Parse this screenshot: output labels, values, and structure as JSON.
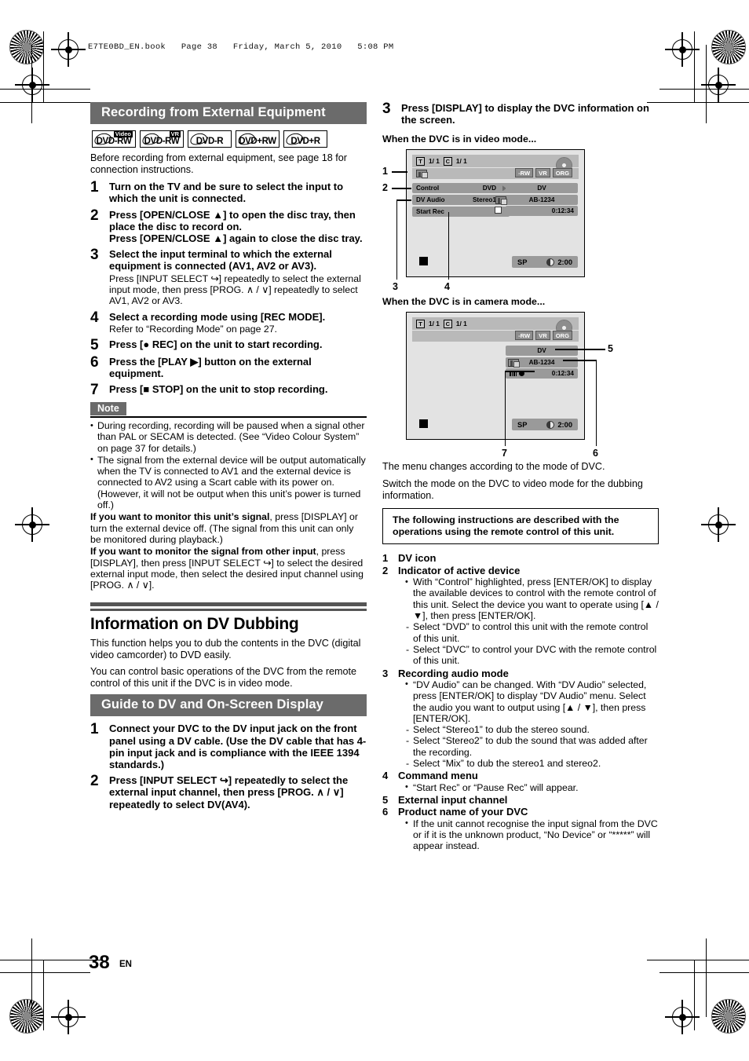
{
  "header": {
    "book_line": "E7TE0BD_EN.book   Page 38   Friday, March 5, 2010   5:08 PM"
  },
  "footer": {
    "page_number": "38",
    "language": "EN"
  },
  "left_column": {
    "section1_title": "Recording from External Equipment",
    "disc_logos": [
      {
        "label": "DVD-RW",
        "sup": "Video"
      },
      {
        "label": "DVD-RW",
        "sup": "VR"
      },
      {
        "label": "DVD-R",
        "sup": ""
      },
      {
        "label": "DVD+RW",
        "sup": ""
      },
      {
        "label": "DVD+R",
        "sup": ""
      }
    ],
    "intro": "Before recording from external equipment, see page 18 for connection instructions.",
    "steps": [
      {
        "num": "1",
        "head": "Turn on the TV and be sure to select the input to which the unit is connected.",
        "sub": ""
      },
      {
        "num": "2",
        "head": "Press [OPEN/CLOSE ▲] to open the disc tray, then place the disc to record on.",
        "head2": "Press [OPEN/CLOSE ▲] again to close the disc tray."
      },
      {
        "num": "3",
        "head": "Select the input terminal to which the external equipment is connected (AV1, AV2 or AV3).",
        "sub": "Press [INPUT SELECT ↪] repeatedly to select the external input mode, then press [PROG. ∧ / ∨] repeatedly to select AV1, AV2 or AV3."
      },
      {
        "num": "4",
        "head": "Select a recording mode using [REC MODE].",
        "sub": "Refer to “Recording Mode” on page 27."
      },
      {
        "num": "5",
        "head": "Press [● REC] on the unit to start recording.",
        "sub": ""
      },
      {
        "num": "6",
        "head": "Press the [PLAY ▶] button on the external equipment.",
        "sub": ""
      },
      {
        "num": "7",
        "head": "Press [■ STOP] on the unit to stop recording.",
        "sub": ""
      }
    ],
    "note_label": "Note",
    "notes": [
      "During recording, recording will be paused when a signal other than PAL or SECAM is detected. (See “Video Colour System” on page 37 for details.)",
      "The signal from the external device will be output automatically when the TV is connected to AV1 and the external device is connected to AV2 using a Scart cable with its power on. (However, it will not be output when this unit’s power is turned off.)"
    ],
    "note_extra_1_bold": "If you want to monitor this unit’s signal",
    "note_extra_1_rest": ", press [DISPLAY] or turn the external device off. (The signal from this unit can only be monitored during playback.)",
    "note_extra_2_bold": "If you want to monitor the signal from other input",
    "note_extra_2_rest": ", press [DISPLAY], then press [INPUT SELECT ↪] to select the desired external input mode, then select the desired input channel using [PROG. ∧ / ∨].",
    "major_title": "Information on DV Dubbing",
    "major_body_1": "This function helps you to dub the contents in the DVC (digital video camcorder) to DVD easily.",
    "major_body_2": "You can control basic operations of the DVC from the remote control of this unit if the DVC is in video mode.",
    "section2_title": "Guide to DV and On-Screen Display",
    "guide_steps": [
      {
        "num": "1",
        "head": "Connect your DVC to the DV input jack on the front panel using a DV cable. (Use the DV cable that has 4-pin input jack and is compliance with the IEEE 1394 standards.)"
      },
      {
        "num": "2",
        "head": "Press [INPUT SELECT ↪] repeatedly to select the external input channel, then press [PROG. ∧ / ∨] repeatedly to select DV(AV4)."
      }
    ]
  },
  "right_column": {
    "step3": {
      "num": "3",
      "head": "Press [DISPLAY] to display the DVC information on the screen."
    },
    "caption_video": "When the DVC is in video mode...",
    "caption_camera": "When the DVC is in camera mode...",
    "osd_video": {
      "title_counter": "1/ 1",
      "chapter_counter": "1/ 1",
      "title_icon": "T",
      "chapter_icon": "C",
      "tags": [
        "-RW",
        "VR",
        "ORG"
      ],
      "menu_rows": [
        {
          "label": "Control",
          "value": "DVD"
        },
        {
          "label": "DV Audio",
          "value": "Stereo1"
        },
        {
          "label": "Start Rec",
          "value": ""
        }
      ],
      "dv_panel": {
        "heading": "DV",
        "product": "AB-1234",
        "time": "0:12:34"
      },
      "rec_mode": "SP",
      "remain": "2:00",
      "callouts": [
        "1",
        "2",
        "3",
        "4"
      ]
    },
    "osd_camera": {
      "title_counter": "1/ 1",
      "chapter_counter": "1/ 1",
      "title_icon": "T",
      "chapter_icon": "C",
      "tags": [
        "-RW",
        "VR",
        "ORG"
      ],
      "dv_panel": {
        "heading": "DV",
        "product": "AB-1234",
        "time": "0:12:34"
      },
      "rec_mode": "SP",
      "remain": "2:00",
      "callouts": [
        "5",
        "6",
        "7"
      ]
    },
    "after_diagram_1": "The menu changes according to the mode of DVC.",
    "after_diagram_2": "Switch the mode on the DVC to video mode for the dubbing information.",
    "framebox": "The following instructions are described with the operations using the remote control of this unit.",
    "legend": [
      {
        "n": "1",
        "t": "DV icon",
        "items": []
      },
      {
        "n": "2",
        "t": "Indicator of active device",
        "items": [
          {
            "type": "b",
            "text": "With “Control” highlighted, press [ENTER/OK] to display the available devices to control with the remote control of this unit. Select the device you want to operate using [▲ / ▼], then press [ENTER/OK]."
          },
          {
            "type": "d",
            "text": "Select “DVD” to control this unit with the remote control of this unit."
          },
          {
            "type": "d",
            "text": "Select “DVC” to control your DVC with the remote control of this unit."
          }
        ]
      },
      {
        "n": "3",
        "t": "Recording audio mode",
        "items": [
          {
            "type": "b",
            "text": "“DV Audio” can be changed. With “DV Audio” selected, press [ENTER/OK] to display “DV Audio” menu. Select the audio you want to output using [▲ / ▼], then press [ENTER/OK]."
          },
          {
            "type": "d",
            "text": "Select “Stereo1” to dub the stereo sound."
          },
          {
            "type": "d",
            "text": "Select “Stereo2” to dub the sound that was added after the recording."
          },
          {
            "type": "d",
            "text": "Select “Mix” to dub the stereo1 and stereo2."
          }
        ]
      },
      {
        "n": "4",
        "t": "Command menu",
        "items": [
          {
            "type": "b",
            "text": "“Start Rec” or “Pause Rec” will appear."
          }
        ]
      },
      {
        "n": "5",
        "t": "External input channel",
        "items": []
      },
      {
        "n": "6",
        "t": "Product name of your DVC",
        "items": [
          {
            "type": "b",
            "text": "If the unit cannot recognise the input signal from the DVC or if it is the unknown product, “No Device” or “*****” will appear instead."
          }
        ]
      }
    ]
  }
}
